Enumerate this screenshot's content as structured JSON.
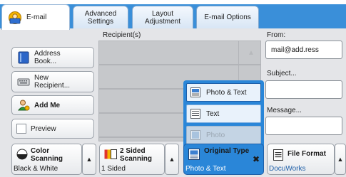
{
  "tabs": [
    {
      "label": "E-mail",
      "active": true
    },
    {
      "label_line1": "Advanced",
      "label_line2": "Settings"
    },
    {
      "label_line1": "Layout",
      "label_line2": "Adjustment"
    },
    {
      "label": "E-mail Options"
    }
  ],
  "recipients": {
    "header": "Recipient(s)"
  },
  "left_buttons": {
    "address_book_line1": "Address",
    "address_book_line2": "Book...",
    "new_recipient_line1": "New",
    "new_recipient_line2": "Recipient...",
    "add_me": "Add Me",
    "preview": "Preview"
  },
  "right_panel": {
    "from_label": "From:",
    "from_value": "mail@add.ress",
    "subject_label": "Subject...",
    "message_label": "Message..."
  },
  "original_type_popup": {
    "options": [
      "Photo & Text",
      "Text",
      "Photo"
    ],
    "selected": "Photo & Text"
  },
  "bottom_bar": {
    "color_scanning_line1": "Color",
    "color_scanning_line2": "Scanning",
    "color_scanning_value": "Black & White",
    "sided_line1": "2 Sided",
    "sided_line2": "Scanning",
    "sided_value": "1 Sided",
    "original_type_head": "Original Type",
    "original_type_value": "Photo & Text",
    "file_format_head": "File Format",
    "file_format_value": "DocuWorks"
  },
  "colors": {
    "accent": "#2a86d8",
    "tabstrip": "#3a8fd9",
    "panel": "#e4e5e8"
  }
}
